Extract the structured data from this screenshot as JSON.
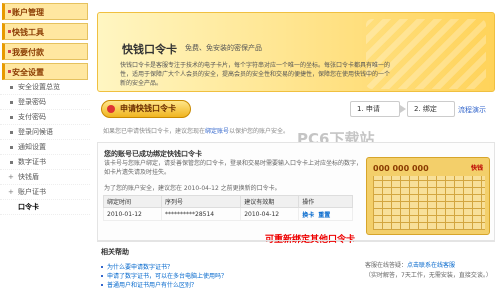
{
  "sidebar": {
    "sections": [
      {
        "label": "账户管理"
      },
      {
        "label": "快钱工具"
      },
      {
        "label": "我要付款"
      },
      {
        "label": "安全设置"
      }
    ],
    "items": [
      {
        "label": "安全设置总览"
      },
      {
        "label": "登录密码"
      },
      {
        "label": "支付密码"
      },
      {
        "label": "登录问候语"
      },
      {
        "label": "通知设置"
      },
      {
        "label": "数字证书"
      },
      {
        "label": "快钱盾"
      },
      {
        "label": "账户证书"
      },
      {
        "label": "口令卡"
      }
    ]
  },
  "banner": {
    "title": "快钱口令卡",
    "subtitle": "免费、免安装的密保产品",
    "description": "快钱口令卡是客服专注于技术的电子卡片，每个字符串对应一个唯一的坐标。每张口令卡都具有唯一的性，适用于保障广大个人会员的安全，提高会员的安全性和交易的便捷性，保障您在使用快钱中的一个新的安全产品。"
  },
  "apply_button": "申请快钱口令卡",
  "steps": {
    "step1": "1. 申请",
    "step2": "2. 绑定",
    "demo": "流程演示"
  },
  "note": {
    "prefix": "如果您已申请快钱口令卡，建议您现在",
    "link": "绑定账号",
    "suffix": "以保护您的账户安全。"
  },
  "bound": {
    "title": "您的账号已成功绑定快钱口令卡",
    "description": "该卡号与您账户绑定，请妥善保管您的口令卡，登录和交易时需要输入口令卡上对应坐标的数字，如卡片遗失请及时挂失。",
    "security": "为了您的账户安全，建议您在 2010-04-12 之前更换新的口令卡。",
    "headers": [
      "绑定时间",
      "序列号",
      "建议有效期",
      "操作"
    ],
    "rows": [
      {
        "time": "2010-01-12",
        "serial": "**********28514",
        "expiry": "2010-04-12",
        "op1": "换卡",
        "op2": "重置"
      }
    ]
  },
  "card": {
    "code": "000 000 000",
    "logo": "快钱"
  },
  "rebind_label": "可重新绑定其他口令卡",
  "help": {
    "title": "相关帮助",
    "items": [
      "为什么要申请数字证书？",
      "申请了数字证书，可以在多台电脑上使用吗？",
      "普通用户和证书用户有什么区别？"
    ],
    "cs_label": "客服在线答疑：",
    "cs_link": "点击联系在线客服",
    "cs_hours": "（实时解答，7天工作，无需安装，直接交谈。）"
  },
  "watermark": "PC6下载站"
}
